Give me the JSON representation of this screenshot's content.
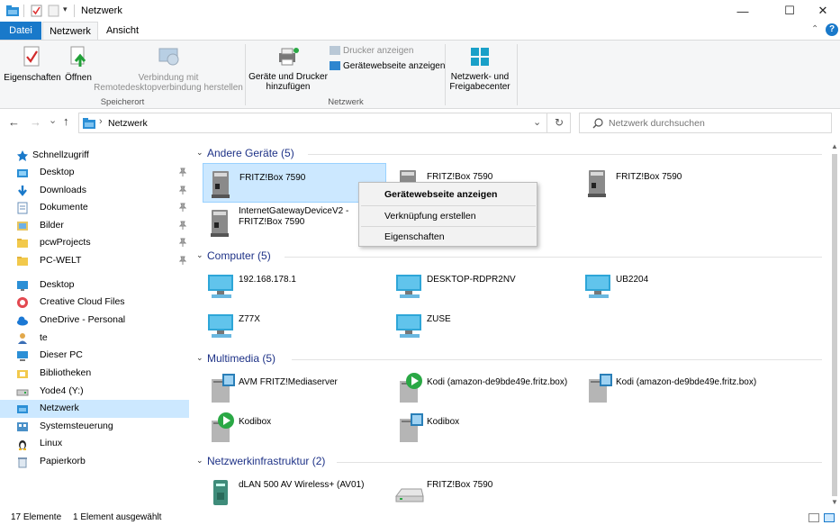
{
  "window": {
    "title": "Netzwerk",
    "minimize": "—",
    "maximize": "☐",
    "close": "✕"
  },
  "ribbon": {
    "tabs": [
      "Datei",
      "Netzwerk",
      "Ansicht"
    ],
    "help": "?",
    "collapse": "⌃",
    "groups": {
      "speicherort": "Speicherort",
      "netzwerk": "Netzwerk"
    },
    "buttons": {
      "eigenschaften": "Eigenschaften",
      "oeffnen": "Öffnen",
      "verbindung_1": "Verbindung mit",
      "verbindung_2": "Remotedesktopverbindung herstellen",
      "geraete_1": "Geräte und Drucker",
      "geraete_2": "hinzufügen",
      "drucker_anzeigen": "Drucker anzeigen",
      "geraetewebseite": "Gerätewebseite anzeigen",
      "netzwerk_1": "Netzwerk- und",
      "netzwerk_2": "Freigabecenter"
    }
  },
  "nav": {
    "back": "←",
    "forward": "→",
    "recent": "⌄",
    "up": "↑",
    "path_sep": "›",
    "path": "Netzwerk",
    "dropdown": "⌄",
    "refresh": "↻",
    "search_placeholder": "Netzwerk durchsuchen"
  },
  "sidebar": {
    "items": [
      {
        "label": "Schnellzugriff",
        "icon": "star-icon",
        "pinned": false
      },
      {
        "label": "Desktop",
        "icon": "desktop-folder-icon",
        "pinned": true
      },
      {
        "label": "Downloads",
        "icon": "download-icon",
        "pinned": true
      },
      {
        "label": "Dokumente",
        "icon": "documents-icon",
        "pinned": true
      },
      {
        "label": "Bilder",
        "icon": "pictures-icon",
        "pinned": true
      },
      {
        "label": "pcwProjects",
        "icon": "folder-icon",
        "pinned": true
      },
      {
        "label": "PC-WELT",
        "icon": "folder-icon",
        "pinned": true
      },
      {
        "label": "Desktop",
        "icon": "desktop-icon",
        "pinned": false
      },
      {
        "label": "Creative Cloud Files",
        "icon": "creative-cloud-icon",
        "pinned": false
      },
      {
        "label": "OneDrive - Personal",
        "icon": "onedrive-icon",
        "pinned": false
      },
      {
        "label": "te",
        "icon": "user-icon",
        "pinned": false
      },
      {
        "label": "Dieser PC",
        "icon": "this-pc-icon",
        "pinned": false
      },
      {
        "label": "Bibliotheken",
        "icon": "libraries-icon",
        "pinned": false
      },
      {
        "label": "Yode4 (Y:)",
        "icon": "drive-icon",
        "pinned": false
      },
      {
        "label": "Netzwerk",
        "icon": "network-icon",
        "pinned": false,
        "selected": true
      },
      {
        "label": "Systemsteuerung",
        "icon": "control-panel-icon",
        "pinned": false
      },
      {
        "label": "Linux",
        "icon": "linux-icon",
        "pinned": false
      },
      {
        "label": "Papierkorb",
        "icon": "recycle-bin-icon",
        "pinned": false
      }
    ]
  },
  "groups": [
    {
      "title": "Andere Geräte (5)",
      "items": [
        {
          "name": "FRITZ!Box 7590",
          "icon": "device-icon",
          "selected": true
        },
        {
          "name": "FRITZ!Box 7590",
          "icon": "device-icon"
        },
        {
          "name": "FRITZ!Box 7590",
          "icon": "device-icon"
        },
        {
          "name": "InternetGatewayDeviceV2 -",
          "name2": "FRITZ!Box 7590",
          "icon": "device-icon"
        }
      ]
    },
    {
      "title": "Computer (5)",
      "items": [
        {
          "name": "192.168.178.1",
          "icon": "monitor-icon"
        },
        {
          "name": "DESKTOP-RDPR2NV",
          "icon": "monitor-icon"
        },
        {
          "name": "UB2204",
          "icon": "monitor-icon"
        },
        {
          "name": "Z77X",
          "icon": "monitor-icon"
        },
        {
          "name": "ZUSE",
          "icon": "monitor-icon"
        }
      ]
    },
    {
      "title": "Multimedia (5)",
      "items": [
        {
          "name": "AVM FRITZ!Mediaserver",
          "icon": "media-server-icon"
        },
        {
          "name": "Kodi (amazon-de9bde49e.fritz.box)",
          "icon": "media-play-icon"
        },
        {
          "name": "Kodi (amazon-de9bde49e.fritz.box)",
          "icon": "media-server-icon"
        },
        {
          "name": "Kodibox",
          "icon": "media-play-icon"
        },
        {
          "name": "Kodibox",
          "icon": "media-server-icon"
        }
      ]
    },
    {
      "title": "Netzwerkinfrastruktur (2)",
      "items": [
        {
          "name": "dLAN 500 AV Wireless+ (AV01)",
          "icon": "powerline-icon"
        },
        {
          "name": "FRITZ!Box 7590",
          "icon": "router-icon"
        }
      ]
    }
  ],
  "context_menu": {
    "items": [
      "Gerätewebseite anzeigen",
      "Verknüpfung erstellen",
      "Eigenschaften"
    ]
  },
  "status": {
    "count": "17 Elemente",
    "selected": "1 Element ausgewählt"
  },
  "colors": {
    "accent": "#1979ca",
    "selection": "#cce8ff",
    "selection_border": "#99d1ff",
    "group_title": "#1e3287"
  }
}
